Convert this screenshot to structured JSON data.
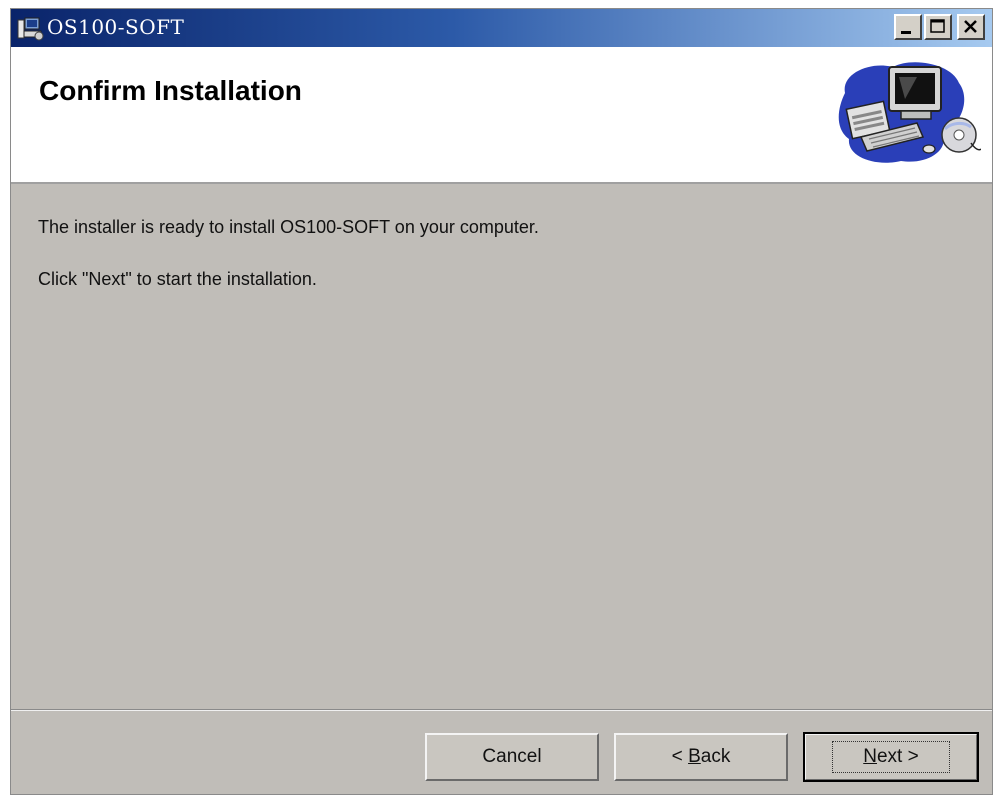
{
  "window": {
    "title": "OS100-SOFT",
    "titlebar_gradient_start": "#0a246a",
    "titlebar_gradient_end": "#a6caf0",
    "body_color": "#c0bdb8",
    "controls": {
      "minimize_icon": "minimize-icon",
      "maximize_icon": "maximize-icon",
      "close_icon": "close-icon"
    }
  },
  "header": {
    "title": "Confirm Installation",
    "graphic_icon": "computer-setup-icon"
  },
  "body": {
    "line1": "The installer is ready to install OS100-SOFT on your computer.",
    "line2": "Click \"Next\" to start the installation."
  },
  "buttons": {
    "cancel": "Cancel",
    "back_arrow": "<",
    "back_mnemonic": "B",
    "back_rest": "ack",
    "next_mnemonic": "N",
    "next_rest": "ext",
    "next_arrow": ">"
  }
}
